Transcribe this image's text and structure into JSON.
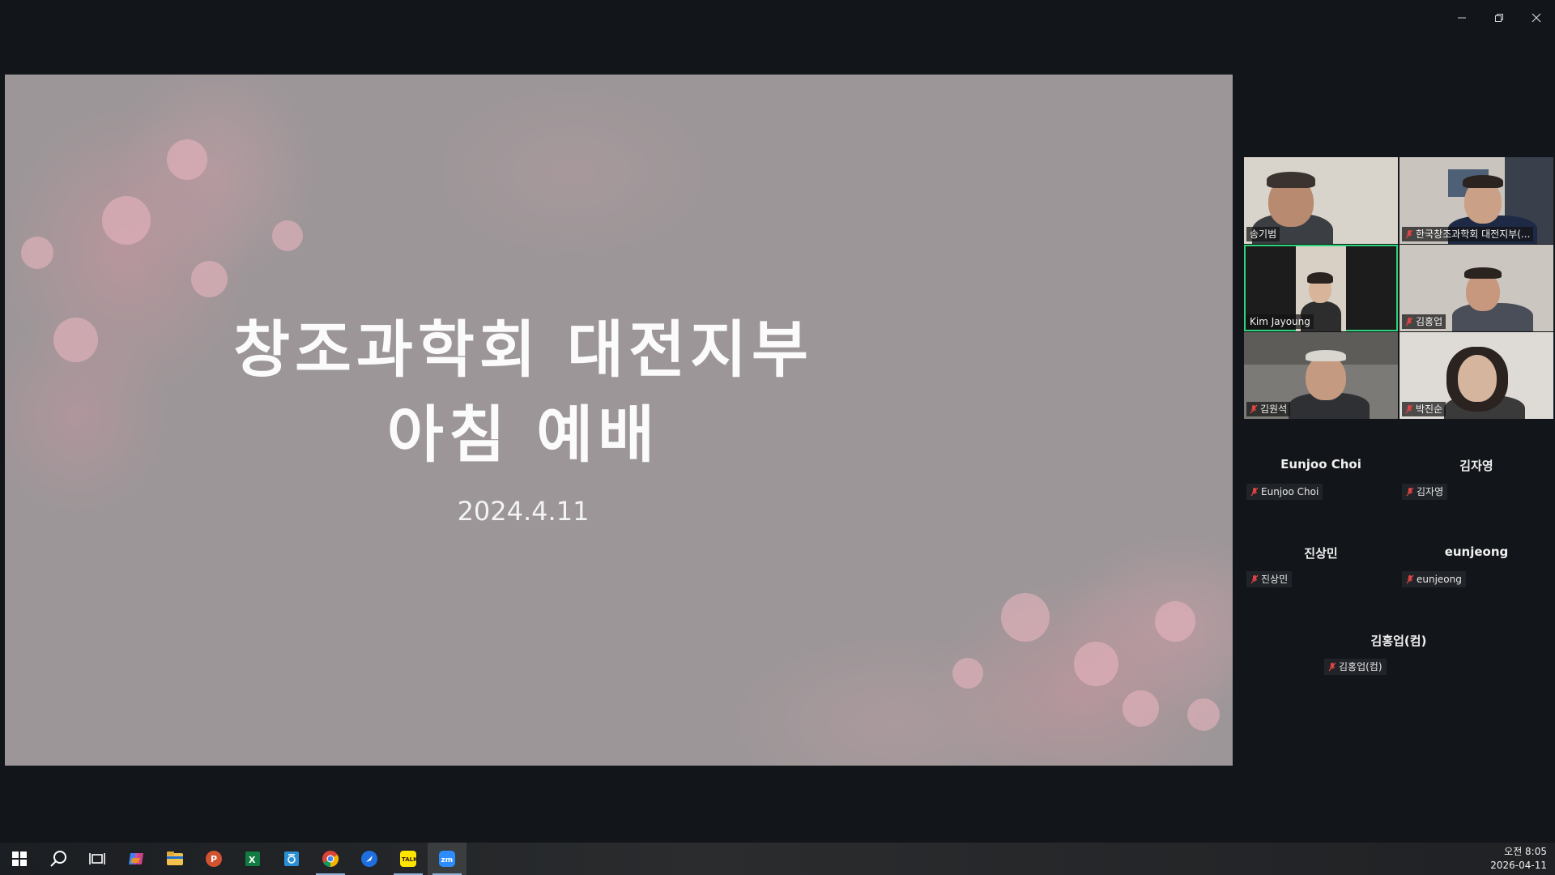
{
  "window": {
    "controls": [
      "minimize-icon",
      "restore-icon",
      "close-icon"
    ]
  },
  "slide": {
    "title_line1": "창조과학회 대전지부",
    "title_line2": "아침 예배",
    "date": "2024.4.11"
  },
  "video_tiles": [
    {
      "name": "송기범",
      "muted": false
    },
    {
      "name": "한국창조과학회 대전지부(...",
      "muted": true
    },
    {
      "name": "Kim Jayoung",
      "muted": false,
      "active_speaker": true
    },
    {
      "name": "김홍업",
      "muted": true
    },
    {
      "name": "김원석",
      "muted": true
    },
    {
      "name": "박진순",
      "muted": true
    }
  ],
  "camera_off_tiles": [
    {
      "display_name": "Eunjoo Choi",
      "tag": "Eunjoo Choi",
      "muted": true
    },
    {
      "display_name": "김자영",
      "tag": "김자영",
      "muted": true
    },
    {
      "display_name": "진상민",
      "tag": "진상민",
      "muted": true
    },
    {
      "display_name": "eunjeong",
      "tag": "eunjeong",
      "muted": true
    },
    {
      "display_name": "김홍업(컴)",
      "tag": "김홍업(컴)",
      "muted": true
    }
  ],
  "taskbar": {
    "apps": [
      "windows-start-icon",
      "search-icon",
      "task-view-icon",
      "copilot-icon",
      "file-explorer-icon",
      "powerpoint-icon",
      "excel-icon",
      "hangul-icon",
      "chrome-icon",
      "arrow-app-icon",
      "kakaotalk-icon",
      "zoom-icon"
    ],
    "kakaotalk_label": "TALK",
    "zoom_label": "zm",
    "time": "오전 8:05",
    "date": "2026-04-11"
  },
  "colors": {
    "background": "#121519",
    "active_speaker_border": "#2fd37a",
    "muted_mic": "#e04444"
  }
}
